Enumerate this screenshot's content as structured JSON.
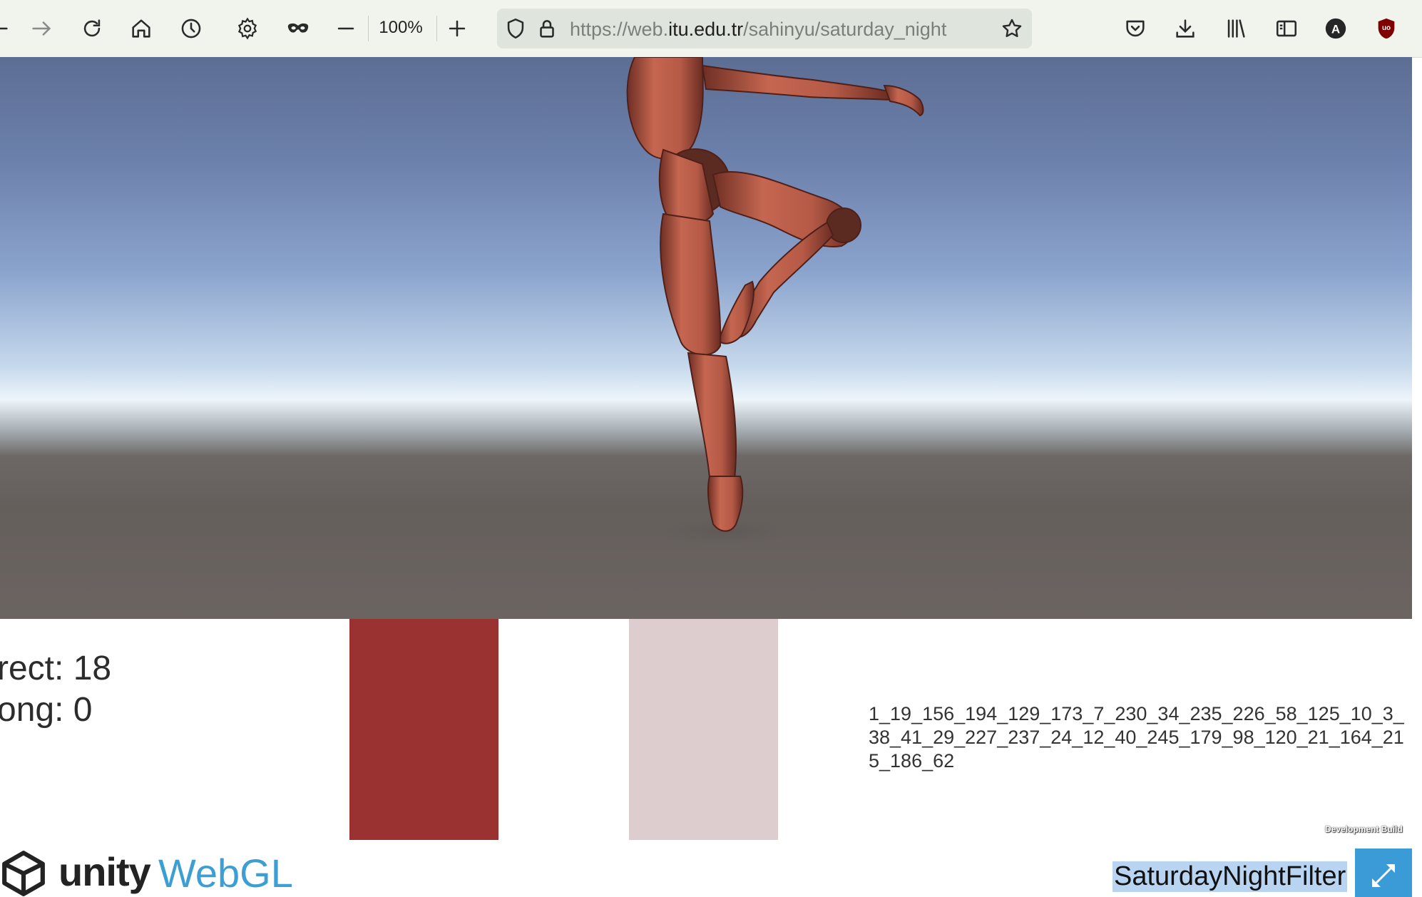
{
  "browser": {
    "zoom_level": "100%",
    "url_prefix": "https://web.",
    "url_host": "itu.edu.tr",
    "url_path": "/sahinyu/saturday_night",
    "account_initial": "A",
    "extension_label": "uo"
  },
  "game": {
    "correct_label": "rect: 18",
    "wrong_label": "ong: 0",
    "swatch_colors": [
      "#9b3232",
      "#ddcdce"
    ],
    "code_string": "1_19_156_194_129_173_7_230_34_235_226_58_125_10_3_38_41_29_227_237_24_12_40_245_179_98_120_21_164_215_186_62",
    "dev_build_label": "Development Build"
  },
  "footer": {
    "unity_label": "unity",
    "webgl_label": "WebGL",
    "title": "SaturdayNightFilter"
  },
  "colors": {
    "figure_skin": "#c56650",
    "webgl_blue": "#3b9fd4",
    "fullscreen_button": "#3a9bd7"
  }
}
